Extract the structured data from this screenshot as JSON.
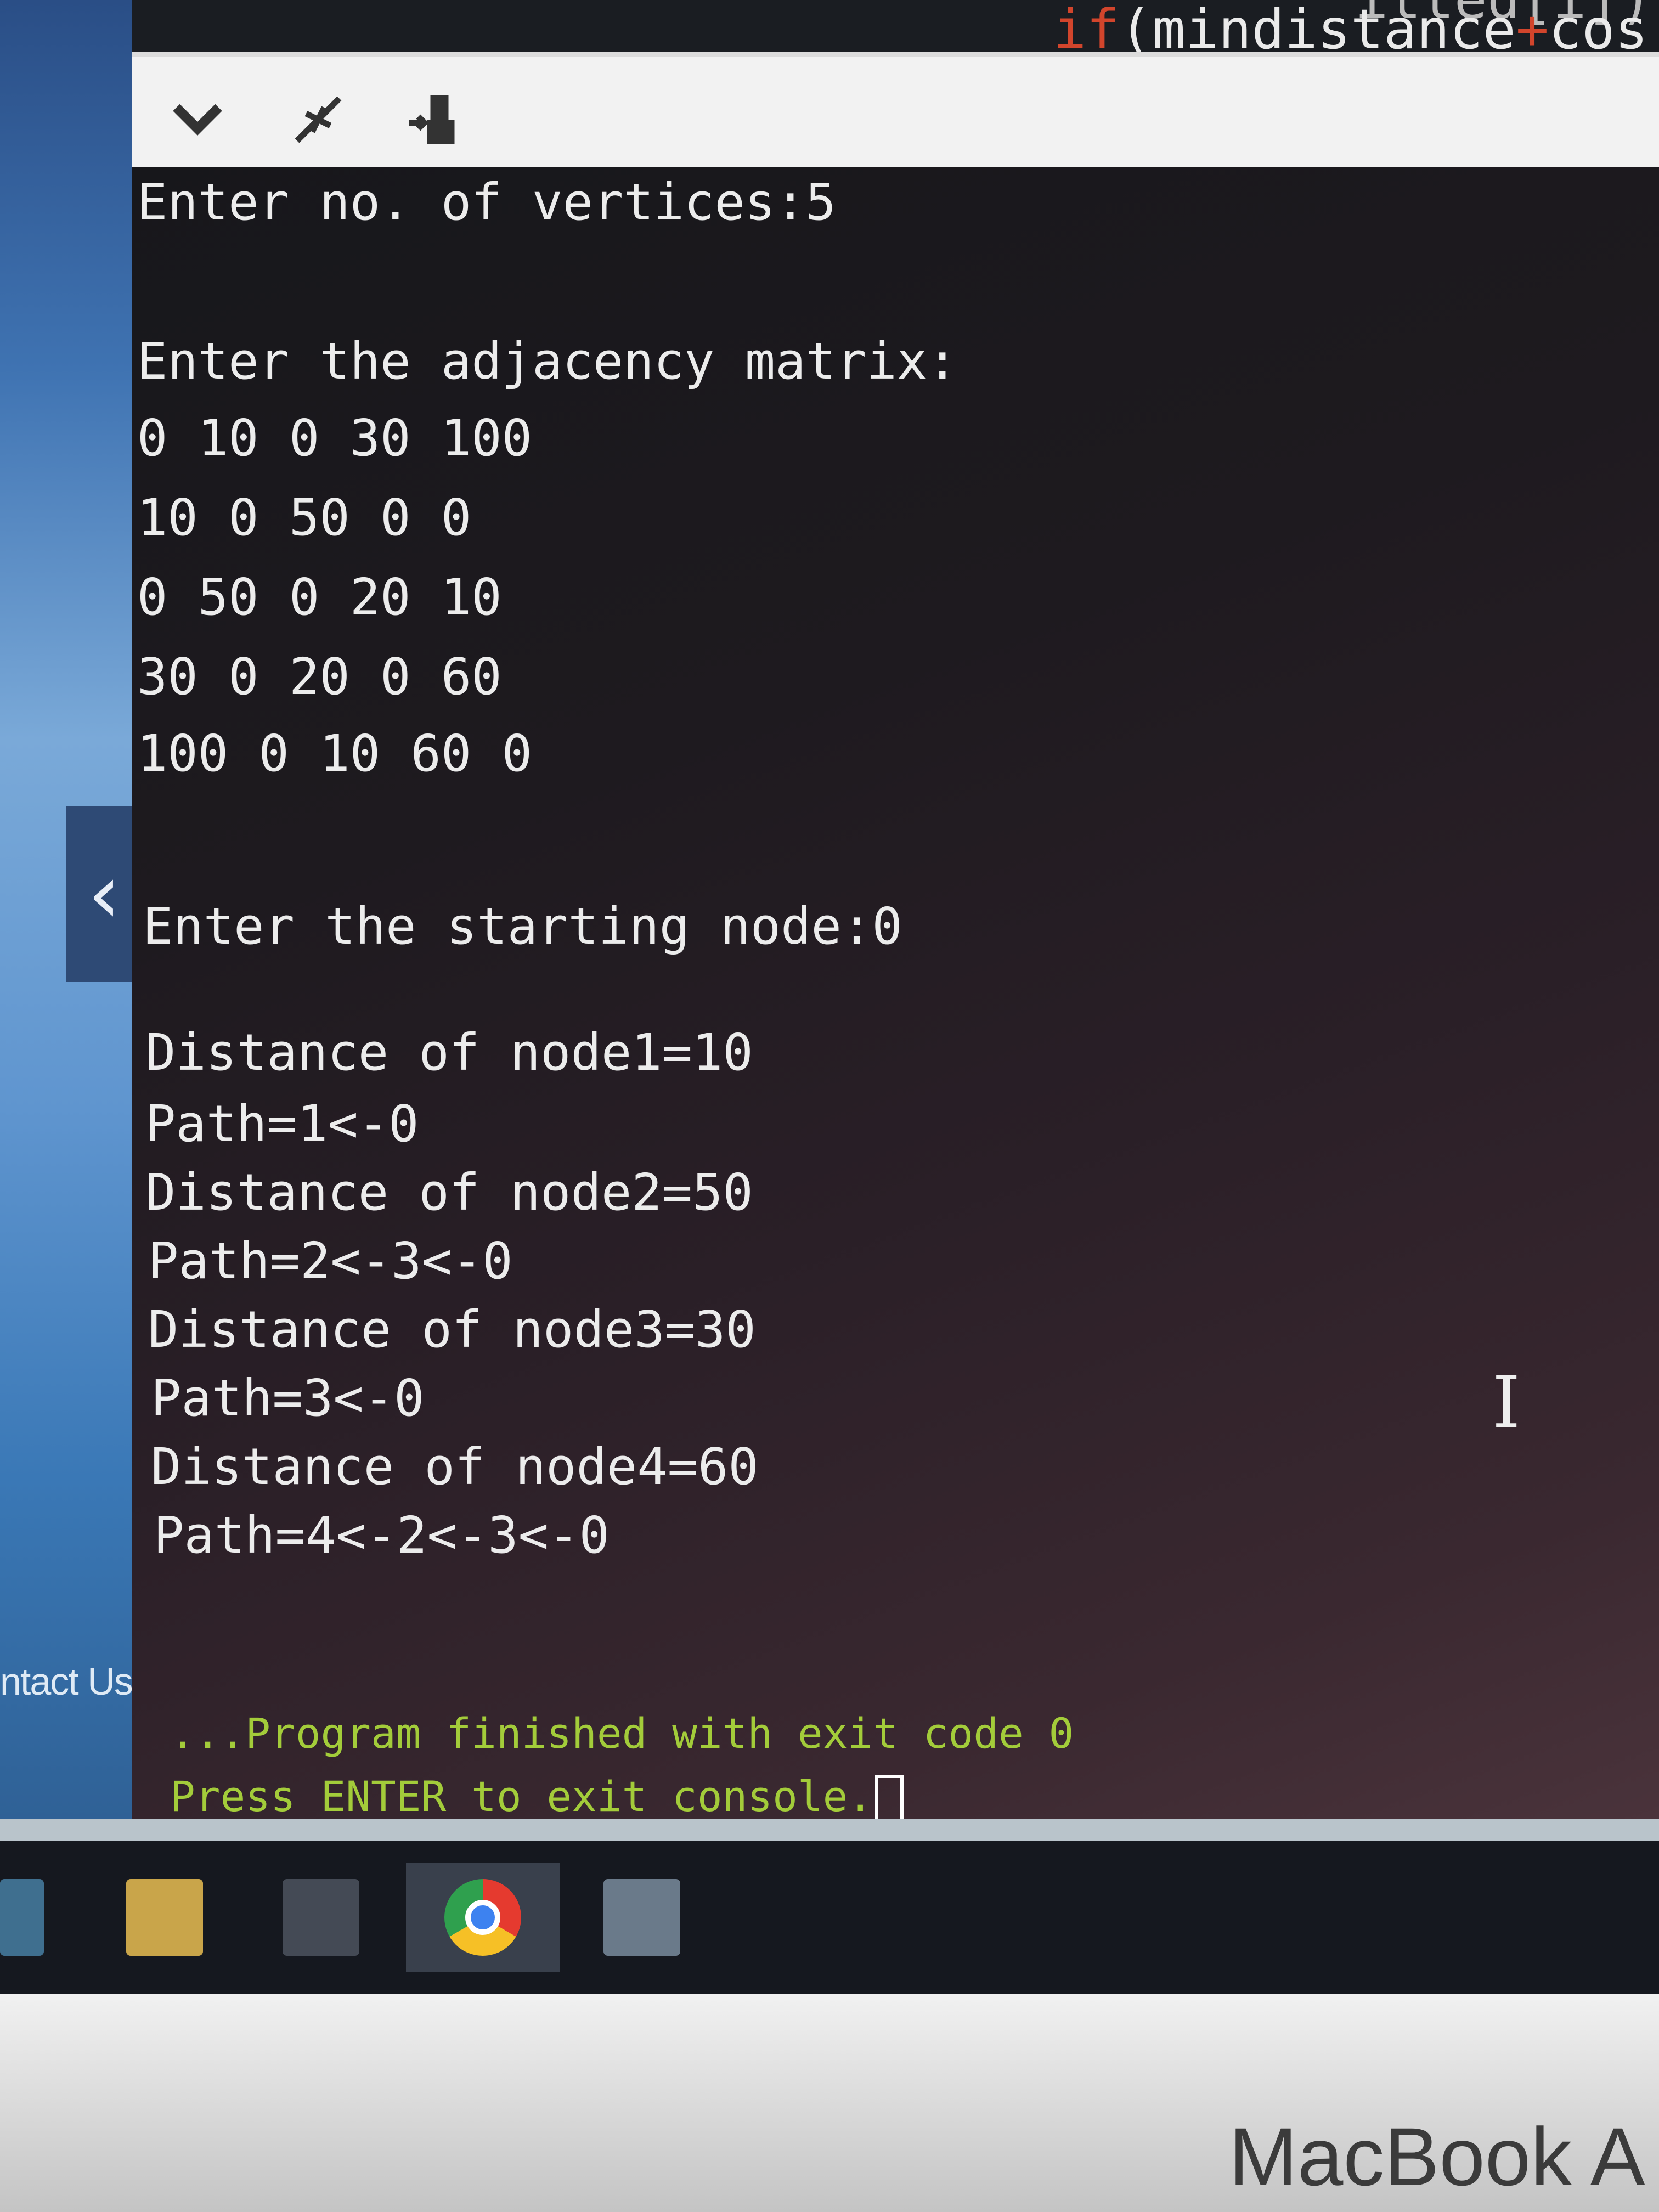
{
  "desktop": {
    "sidebar_text": "ntact Us",
    "back_icon": "chevron-left-icon"
  },
  "editor": {
    "top_code": "itted[i])",
    "code_keyword": "if",
    "code_text": "(mindistance",
    "code_op": "+",
    "code_tail": "cos"
  },
  "toolbar": {
    "icons": [
      "chevron-down-icon",
      "collapse-icon",
      "stop-run-icon"
    ]
  },
  "console": {
    "lines": [
      "Enter no. of vertices:5",
      "Enter the adjacency matrix:",
      "0 10 0 30 100",
      "10 0 50 0 0",
      "0 50 0 20 10",
      "30 0 20 0 60",
      "100 0 10 60 0",
      "Enter the starting node:0",
      "Distance of node1=10",
      "Path=1<-0",
      "Distance of node2=50",
      "Path=2<-3<-0",
      "Distance of node3=30",
      "Path=3<-0",
      "Distance of node4=60",
      "Path=4<-2<-3<-0"
    ],
    "finished": "...Program finished with exit code 0",
    "press_enter": "Press ENTER to exit console."
  },
  "taskbar": {
    "apps": [
      "mail-icon",
      "file-explorer-icon",
      "camera-icon",
      "chrome-icon",
      "store-icon"
    ]
  },
  "bezel": {
    "brand": "MacBook A"
  }
}
